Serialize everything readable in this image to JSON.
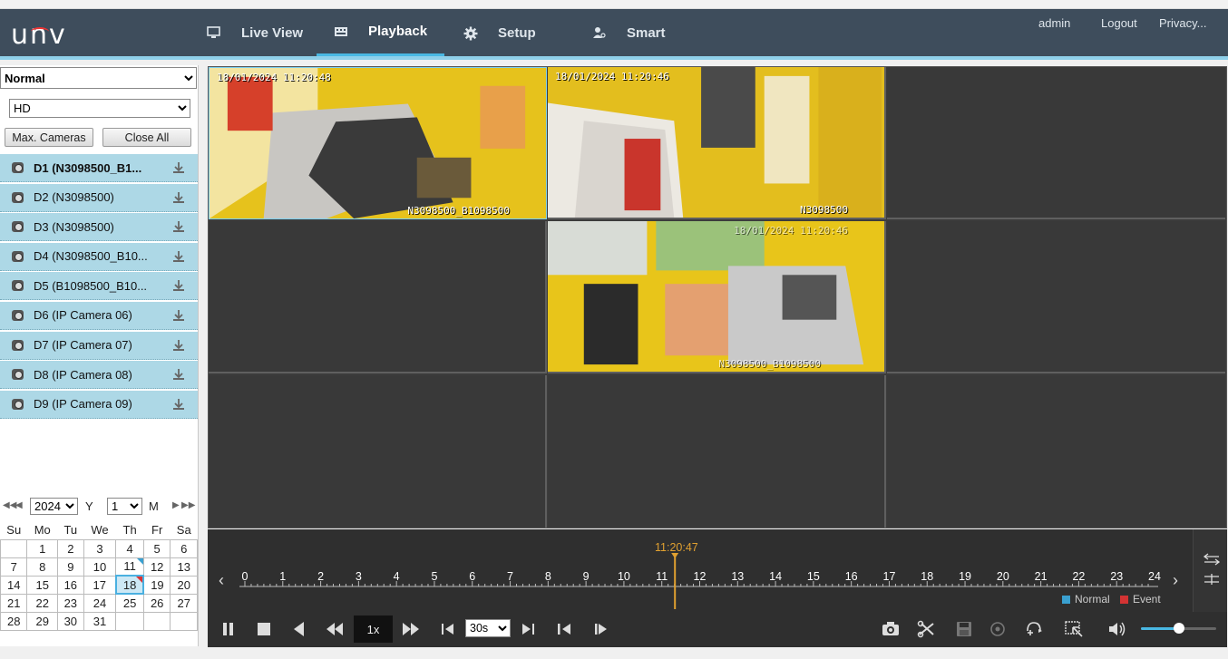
{
  "header": {
    "logo": "unv",
    "nav": [
      {
        "label": "Live View"
      },
      {
        "label": "Playback"
      },
      {
        "label": "Setup"
      },
      {
        "label": "Smart"
      }
    ],
    "user": "admin",
    "logout": "Logout",
    "privacy": "Privacy..."
  },
  "left": {
    "mode_select": "Normal",
    "quality_select": "HD",
    "max_cameras": "Max. Cameras",
    "close_all": "Close All",
    "cameras": [
      {
        "label": "D1 (N3098500_B1..."
      },
      {
        "label": "D2 (N3098500)"
      },
      {
        "label": "D3 (N3098500)"
      },
      {
        "label": "D4 (N3098500_B10..."
      },
      {
        "label": "D5 (B1098500_B10..."
      },
      {
        "label": "D6 (IP Camera 06)"
      },
      {
        "label": "D7 (IP Camera 07)"
      },
      {
        "label": "D8 (IP Camera 08)"
      },
      {
        "label": "D9 (IP Camera 09)"
      }
    ]
  },
  "calendar": {
    "year": "2024",
    "year_label": "Y",
    "month": "1",
    "month_label": "M",
    "weekdays": [
      "Su",
      "Mo",
      "Tu",
      "We",
      "Th",
      "Fr",
      "Sa"
    ],
    "weeks": [
      [
        "",
        "1",
        "2",
        "3",
        "4",
        "5",
        "6"
      ],
      [
        "7",
        "8",
        "9",
        "10",
        "11",
        "12",
        "13"
      ],
      [
        "14",
        "15",
        "16",
        "17",
        "18",
        "19",
        "20"
      ],
      [
        "21",
        "22",
        "23",
        "24",
        "25",
        "26",
        "27"
      ],
      [
        "28",
        "29",
        "30",
        "31",
        "",
        "",
        ""
      ]
    ],
    "selected_day": "18"
  },
  "video": {
    "tile1_time": "18/01/2024 11:20:48",
    "tile1_name": "N3098500_B1098500",
    "tile2_time": "18/01/2024 11:20:46",
    "tile2_name": "N3098500",
    "tile5_time": "18/01/2024 11:20:46",
    "tile5_name": "N3098500_B1098500"
  },
  "timeline": {
    "current_time": "11:20:47",
    "hours": [
      "0",
      "1",
      "2",
      "3",
      "4",
      "5",
      "6",
      "7",
      "8",
      "9",
      "10",
      "11",
      "12",
      "13",
      "14",
      "15",
      "16",
      "17",
      "18",
      "19",
      "20",
      "21",
      "22",
      "23",
      "24"
    ],
    "legend_normal": "Normal",
    "legend_event": "Event",
    "speed": "1x",
    "step": "30s",
    "volume_level": 0.5
  },
  "colors": {
    "header_bg": "#3e4d5c",
    "accent": "#49b8e3",
    "camera_row": "#add8e6",
    "cursor": "#e0a030",
    "normal": "#3aa0d0",
    "event": "#d33333"
  }
}
